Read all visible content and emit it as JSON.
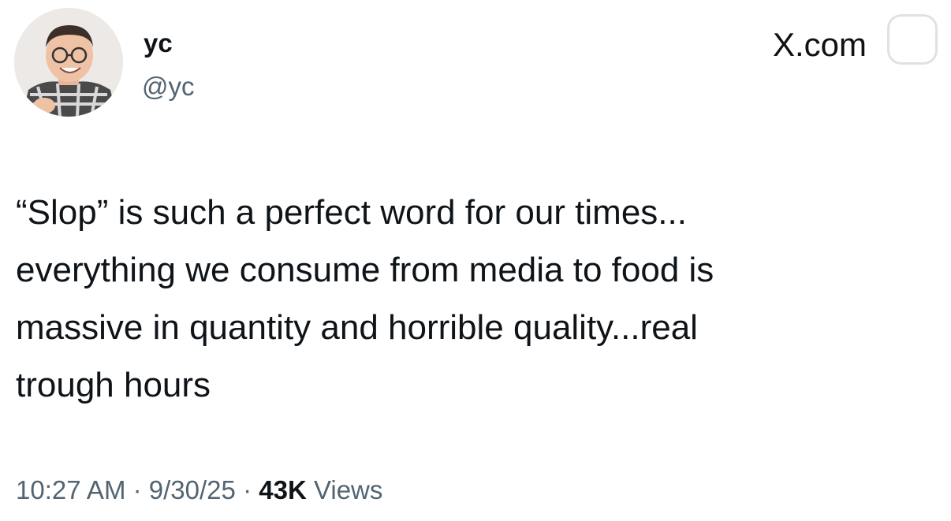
{
  "author": {
    "display_name": "yc",
    "handle": "@yc"
  },
  "watermark": {
    "text": "X.com"
  },
  "tweet": {
    "lines": [
      "“Slop” is such a perfect word for our times...",
      "everything we consume from media to food is",
      "massive in quantity and horrible quality...real",
      "trough hours"
    ]
  },
  "meta": {
    "time": "10:27 AM",
    "separator": "·",
    "date": "9/30/25",
    "views_count": "43K",
    "views_label": "Views"
  },
  "icons": {
    "avatar": "person-photo"
  }
}
